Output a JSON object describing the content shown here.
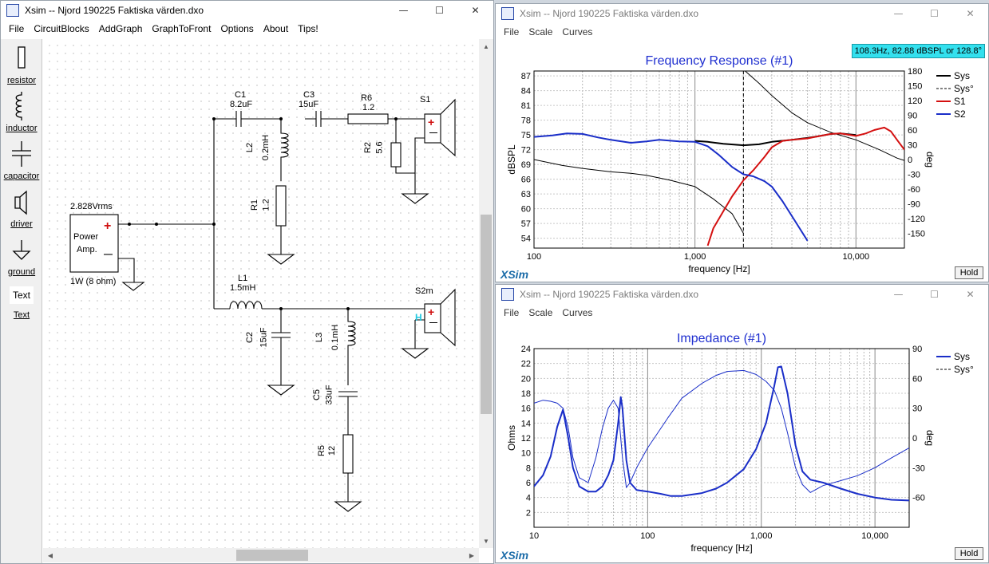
{
  "main_window": {
    "title": "Xsim -- Njord 190225 Faktiska värden.dxo",
    "menu": [
      "File",
      "CircuitBlocks",
      "AddGraph",
      "GraphToFront",
      "Options",
      "About",
      "Tips!"
    ]
  },
  "palette": {
    "items": [
      {
        "name": "resistor",
        "label": "resistor"
      },
      {
        "name": "inductor",
        "label": "inductor"
      },
      {
        "name": "capacitor",
        "label": "capacitor"
      },
      {
        "name": "driver",
        "label": "driver"
      },
      {
        "name": "ground",
        "label": "ground"
      },
      {
        "name": "text",
        "label": "Text",
        "icon_text": "Text"
      }
    ]
  },
  "circuit": {
    "source": {
      "voltage": "2.828Vrms",
      "line1": "Power",
      "line2": "Amp.",
      "plus": "+",
      "minus": "—",
      "load": "1W (8 ohm)"
    },
    "components": {
      "C1": {
        "name": "C1",
        "value": "8.2uF"
      },
      "C3": {
        "name": "C3",
        "value": "15uF"
      },
      "R6": {
        "name": "R6",
        "value": "1.2"
      },
      "L2": {
        "name": "L2",
        "value": "0.2mH"
      },
      "R2": {
        "name": "R2",
        "value": "5.6"
      },
      "R1": {
        "name": "R1",
        "value": "1.2"
      },
      "L1": {
        "name": "L1",
        "value": "1.5mH"
      },
      "C2": {
        "name": "C2",
        "value": "15uF"
      },
      "L3": {
        "name": "L3",
        "value": "0.1mH"
      },
      "C5": {
        "name": "C5",
        "value": "33uF"
      },
      "R5": {
        "name": "R5",
        "value": "12"
      }
    },
    "drivers": {
      "S1": {
        "name": "S1",
        "plus": "+",
        "minus": "—"
      },
      "S2m": {
        "name": "S2m",
        "plus": "+",
        "minus": "—",
        "marker": "H"
      }
    }
  },
  "fr_window": {
    "title": "Xsim -- Njord 190225 Faktiska värden.dxo",
    "menu": [
      "File",
      "Scale",
      "Curves"
    ],
    "readout": "108.3Hz, 82.88 dBSPL or 128.8°",
    "hold_label": "Hold",
    "brand": "XSim"
  },
  "imp_window": {
    "title": "Xsim -- Njord 190225 Faktiska värden.dxo",
    "menu": [
      "File",
      "Scale",
      "Curves"
    ],
    "hold_label": "Hold",
    "brand": "XSim"
  },
  "window_controls": {
    "minimize": "—",
    "maximize": "☐",
    "close": "✕"
  },
  "colors": {
    "title_blue": "#1f2fd0",
    "sys": "#000000",
    "s1": "#d41010",
    "s2": "#1a2ec8",
    "imp": "#1a2ec8",
    "brand": "#1a6ba8",
    "readout_bg": "#33e0ee"
  },
  "chart_data": [
    {
      "type": "line",
      "title": "Frequency Response (#1)",
      "xlabel": "frequency [Hz]",
      "ylabel": "dBSPL",
      "y2label": "deg",
      "xscale": "log",
      "xlim": [
        100,
        20000
      ],
      "ylim": [
        52,
        88
      ],
      "y2lim": [
        -180,
        180
      ],
      "xticks": [
        {
          "v": 100,
          "l": "100"
        },
        {
          "v": 1000,
          "l": "1,000"
        },
        {
          "v": 10000,
          "l": "10,000"
        }
      ],
      "yticks": [
        54,
        57,
        60,
        63,
        66,
        69,
        72,
        75,
        78,
        81,
        84,
        87
      ],
      "y2ticks": [
        {
          "v": 180,
          "l": "180"
        },
        {
          "v": 150,
          "l": "150"
        },
        {
          "v": 120,
          "l": "120"
        },
        {
          "v": 90,
          "l": "90"
        },
        {
          "v": 60,
          "l": "60"
        },
        {
          "v": 30,
          "l": "30"
        },
        {
          "v": 0,
          "l": "0"
        },
        {
          "v": -30,
          "l": "-30"
        },
        {
          "v": -60,
          "l": "-60"
        },
        {
          "v": -90,
          "l": "-90"
        },
        {
          "v": -120,
          "l": "-120"
        },
        {
          "v": -150,
          "l": "-150"
        }
      ],
      "cursor_x": 2000,
      "legend": [
        {
          "name": "Sys",
          "color": "#000000",
          "dash": false
        },
        {
          "name": "Sys°",
          "color": "#000000",
          "dash": true
        },
        {
          "name": "S1",
          "color": "#d41010",
          "dash": false
        },
        {
          "name": "S2",
          "color": "#1a2ec8",
          "dash": false
        }
      ],
      "series": [
        {
          "name": "Sys",
          "axis": "left",
          "color": "#000000",
          "width": 2,
          "points": [
            [
              1000,
              73.8
            ],
            [
              1200,
              73.6
            ],
            [
              1500,
              73.2
            ],
            [
              2000,
              72.9
            ],
            [
              2500,
              73.1
            ],
            [
              3000,
              73.6
            ],
            [
              4000,
              74.0
            ],
            [
              5000,
              74.4
            ],
            [
              6000,
              74.8
            ],
            [
              7000,
              75.2
            ],
            [
              8000,
              75.3
            ],
            [
              10000,
              75.0
            ]
          ]
        },
        {
          "name": "Sys°",
          "axis": "right",
          "color": "#000000",
          "width": 1,
          "points": [
            [
              100,
              0
            ],
            [
              150,
              -12
            ],
            [
              200,
              -18
            ],
            [
              300,
              -25
            ],
            [
              400,
              -28
            ],
            [
              500,
              -32
            ],
            [
              700,
              -42
            ],
            [
              1000,
              -55
            ],
            [
              1300,
              -80
            ],
            [
              1700,
              -110
            ],
            [
              2000,
              -150
            ],
            [
              2050,
              180
            ],
            [
              2500,
              155
            ],
            [
              3000,
              130
            ],
            [
              4000,
              95
            ],
            [
              5000,
              75
            ],
            [
              7000,
              55
            ],
            [
              10000,
              40
            ],
            [
              14000,
              20
            ],
            [
              18000,
              3
            ],
            [
              20000,
              -2
            ]
          ]
        },
        {
          "name": "S1",
          "axis": "left",
          "color": "#d41010",
          "width": 2,
          "points": [
            [
              1200,
              52.5
            ],
            [
              1300,
              56
            ],
            [
              1500,
              59.5
            ],
            [
              1700,
              62.5
            ],
            [
              2000,
              65.8
            ],
            [
              2300,
              67.8
            ],
            [
              2700,
              70.5
            ],
            [
              3000,
              72.5
            ],
            [
              3500,
              73.8
            ],
            [
              4000,
              74.0
            ],
            [
              5000,
              74.3
            ],
            [
              6000,
              74.8
            ],
            [
              7000,
              75.2
            ],
            [
              8000,
              75.3
            ],
            [
              10000,
              74.8
            ],
            [
              11500,
              75.3
            ],
            [
              13000,
              76.0
            ],
            [
              15000,
              76.5
            ],
            [
              16500,
              75.7
            ],
            [
              18000,
              74.0
            ],
            [
              20000,
              72.0
            ]
          ]
        },
        {
          "name": "S2",
          "axis": "left",
          "color": "#1a2ec8",
          "width": 2,
          "points": [
            [
              100,
              74.6
            ],
            [
              130,
              74.9
            ],
            [
              160,
              75.3
            ],
            [
              200,
              75.2
            ],
            [
              250,
              74.5
            ],
            [
              300,
              74.0
            ],
            [
              400,
              73.4
            ],
            [
              500,
              73.7
            ],
            [
              600,
              74.0
            ],
            [
              800,
              73.7
            ],
            [
              1000,
              73.6
            ],
            [
              1200,
              72.7
            ],
            [
              1400,
              71.0
            ],
            [
              1700,
              68.5
            ],
            [
              2000,
              67.0
            ],
            [
              2300,
              66.6
            ],
            [
              2700,
              65.6
            ],
            [
              3000,
              64.5
            ],
            [
              3500,
              61.5
            ],
            [
              4000,
              58.5
            ],
            [
              5000,
              53.5
            ]
          ]
        }
      ]
    },
    {
      "type": "line",
      "title": "Impedance (#1)",
      "xlabel": "frequency [Hz]",
      "ylabel": "Ohms",
      "y2label": "deg",
      "xscale": "log",
      "xlim": [
        10,
        20000
      ],
      "ylim": [
        0,
        24
      ],
      "y2lim": [
        -90,
        90
      ],
      "xticks": [
        {
          "v": 10,
          "l": "10"
        },
        {
          "v": 100,
          "l": "100"
        },
        {
          "v": 1000,
          "l": "1,000"
        },
        {
          "v": 10000,
          "l": "10,000"
        }
      ],
      "yticks": [
        2,
        4,
        6,
        8,
        10,
        12,
        14,
        16,
        18,
        20,
        22,
        24
      ],
      "y2ticks": [
        {
          "v": 90,
          "l": "90"
        },
        {
          "v": 60,
          "l": "60"
        },
        {
          "v": 30,
          "l": "30"
        },
        {
          "v": 0,
          "l": "0"
        },
        {
          "v": -30,
          "l": "-30"
        },
        {
          "v": -60,
          "l": "-60"
        }
      ],
      "legend": [
        {
          "name": "Sys",
          "color": "#1a2ec8",
          "dash": false
        },
        {
          "name": "Sys°",
          "color": "#000000",
          "dash": true
        }
      ],
      "series": [
        {
          "name": "Sys",
          "axis": "left",
          "color": "#1a2ec8",
          "width": 2,
          "points": [
            [
              10,
              5.5
            ],
            [
              12,
              7
            ],
            [
              14,
              9.5
            ],
            [
              16,
              13.5
            ],
            [
              18,
              15.8
            ],
            [
              20,
              12
            ],
            [
              22,
              8
            ],
            [
              25,
              5.5
            ],
            [
              30,
              4.8
            ],
            [
              35,
              4.8
            ],
            [
              40,
              5.5
            ],
            [
              45,
              7
            ],
            [
              50,
              9
            ],
            [
              55,
              14
            ],
            [
              58,
              17.5
            ],
            [
              60,
              16
            ],
            [
              65,
              9
            ],
            [
              70,
              6
            ],
            [
              80,
              5
            ],
            [
              100,
              4.8
            ],
            [
              130,
              4.5
            ],
            [
              160,
              4.2
            ],
            [
              200,
              4.2
            ],
            [
              300,
              4.6
            ],
            [
              400,
              5.2
            ],
            [
              500,
              6
            ],
            [
              700,
              7.8
            ],
            [
              900,
              10.5
            ],
            [
              1100,
              14
            ],
            [
              1300,
              19
            ],
            [
              1400,
              21.5
            ],
            [
              1500,
              21.6
            ],
            [
              1700,
              18
            ],
            [
              2000,
              11
            ],
            [
              2300,
              7.5
            ],
            [
              2700,
              6.4
            ],
            [
              3500,
              6
            ],
            [
              5000,
              5.2
            ],
            [
              7000,
              4.5
            ],
            [
              10000,
              4.0
            ],
            [
              14000,
              3.7
            ],
            [
              20000,
              3.6
            ]
          ]
        },
        {
          "name": "Sys°",
          "axis": "right",
          "color": "#1a2ec8",
          "width": 1,
          "points": [
            [
              10,
              35
            ],
            [
              12,
              38
            ],
            [
              14,
              37
            ],
            [
              16,
              35
            ],
            [
              18,
              30
            ],
            [
              20,
              10
            ],
            [
              22,
              -20
            ],
            [
              25,
              -40
            ],
            [
              30,
              -45
            ],
            [
              35,
              -20
            ],
            [
              40,
              10
            ],
            [
              45,
              30
            ],
            [
              50,
              38
            ],
            [
              55,
              30
            ],
            [
              60,
              -20
            ],
            [
              65,
              -50
            ],
            [
              70,
              -45
            ],
            [
              80,
              -30
            ],
            [
              100,
              -10
            ],
            [
              150,
              20
            ],
            [
              200,
              40
            ],
            [
              300,
              55
            ],
            [
              400,
              63
            ],
            [
              500,
              67
            ],
            [
              700,
              68
            ],
            [
              900,
              64
            ],
            [
              1100,
              57
            ],
            [
              1300,
              48
            ],
            [
              1500,
              30
            ],
            [
              1700,
              5
            ],
            [
              2000,
              -30
            ],
            [
              2300,
              -47
            ],
            [
              2700,
              -55
            ],
            [
              3500,
              -48
            ],
            [
              5000,
              -43
            ],
            [
              7000,
              -38
            ],
            [
              10000,
              -30
            ],
            [
              14000,
              -20
            ],
            [
              20000,
              -10
            ]
          ]
        }
      ]
    }
  ]
}
